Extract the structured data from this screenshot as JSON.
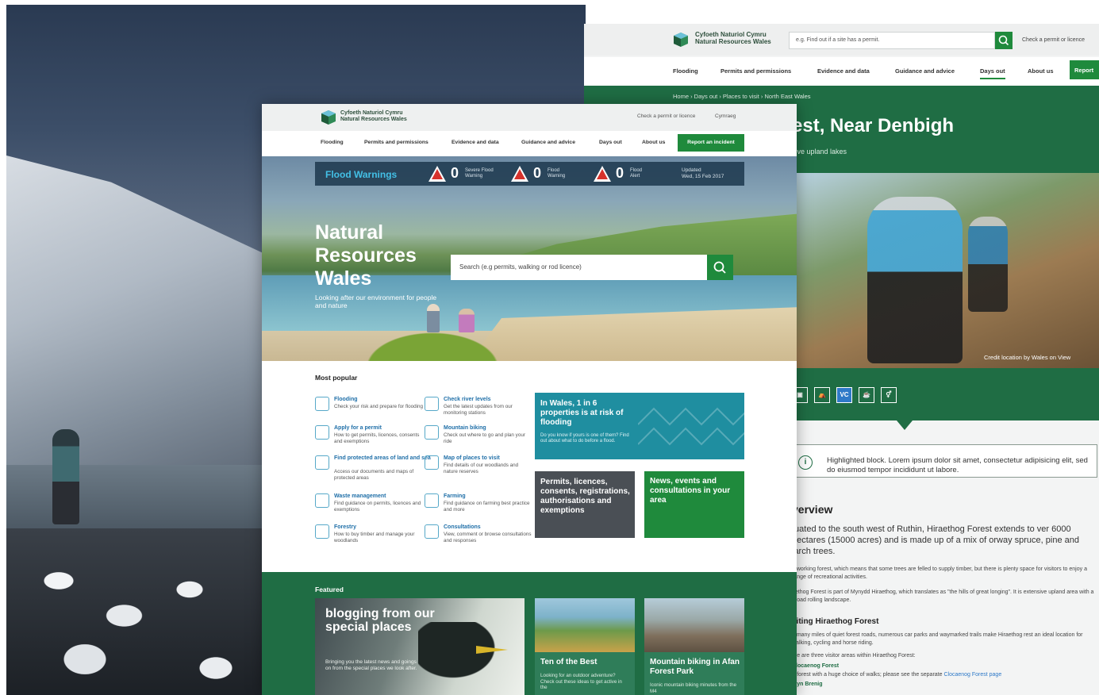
{
  "right_page": {
    "brand_line1": "Cyfoeth Naturiol Cymru",
    "brand_line2": "Natural Resources Wales",
    "search_placeholder": "e.g. Find out if a site has a permit.",
    "check_link": "Check a permit or licence",
    "nav": [
      "Flooding",
      "Permits and permissions",
      "Evidence and data",
      "Guidance and advice",
      "Days out",
      "About us"
    ],
    "report_button": "Report",
    "breadcrumb": "Home  ›  Days out  ›  Places to visit  ›  North East Wales",
    "title": "est, Near Denbigh",
    "subtitle": "sive upland lakes",
    "photo_credit": "Credit location by Wales on View",
    "facility_icons": [
      "parking-icon",
      "picnic-icon",
      "visitor-centre-icon",
      "cafe-icon",
      "toilets-icon"
    ],
    "facility_vc": "VC",
    "highlight": "Highlighted block. Lorem ipsum dolor sit amet, consectetur adipisicing elit, sed do eiusmod tempor incididunt ut labore.",
    "overview_heading": "verview",
    "overview_p1": "tuated to the south west of Ruthin, Hiraethog Forest extends to ver 6000 hectares (15000 acres) and is made up of a mix of orway spruce, pine and larch trees.",
    "overview_p2": "a working forest, which means that some trees are felled to supply timber, but there is plenty space for visitors to enjoy a range of recreational activities.",
    "overview_p3": "aethog Forest is part of Mynydd Hiraethog, which translates as \"the hills of great longing\". It is extensive upland area with a broad rolling landscape.",
    "visiting_heading": "siting Hiraethog Forest",
    "visiting_p1": "e many miles of quiet forest roads, numerous car parks and waymarked trails make Hiraethog rest an ideal location for walking, cycling and horse riding.",
    "visiting_p2": "ere are three visitor areas within Hiraethog Forest:",
    "link1": "Clocaenog Forest",
    "link1_desc": "A forest with a huge choice of walks; please see the separate ",
    "link1_desc_link": "Clocaenog Forest page",
    "link2": "Llyn Brenig"
  },
  "main_page": {
    "brand_line1": "Cyfoeth Naturiol Cymru",
    "brand_line2": "Natural Resources Wales",
    "check_link": "Check a permit or licence",
    "language_link": "Cymraeg",
    "nav": [
      "Flooding",
      "Permits and permissions",
      "Evidence and data",
      "Guidance and advice",
      "Days out",
      "About us"
    ],
    "report_button": "Report an incident",
    "flood": {
      "title": "Flood Warnings",
      "items": [
        {
          "count": "0",
          "label1": "Severe Flood",
          "label2": "Warning"
        },
        {
          "count": "0",
          "label1": "Flood",
          "label2": "Warning"
        },
        {
          "count": "0",
          "label1": "Flood",
          "label2": "Alert"
        }
      ],
      "updated_label": "Updated",
      "updated_date": "Wed, 15 Feb 2017"
    },
    "hero_title": "Natural\nResources\nWales",
    "hero_subtitle": "Looking after our environment for people and nature",
    "search_placeholder": "Search (e.g permits, walking or rod licence)",
    "most_popular_title": "Most popular",
    "popular": [
      {
        "title": "Flooding",
        "desc": "Check your risk and prepare for flooding"
      },
      {
        "title": "Check river levels",
        "desc": "Get the latest updates from our monitoring stations"
      },
      {
        "title": "Apply for a permit",
        "desc": "How to get permits, licences, consents and exemptions"
      },
      {
        "title": "Mountain biking",
        "desc": "Check out where to go and plan your ride"
      },
      {
        "title": "Find protected areas of land and sea",
        "desc": "Access our documents and maps of protected areas"
      },
      {
        "title": "Map of places to visit",
        "desc": "Find details of our woodlands and nature reserves"
      },
      {
        "title": "Waste management",
        "desc": "Find guidance on permits, licences and exemptions"
      },
      {
        "title": "Farming",
        "desc": "Find guidance on farming best practice and more"
      },
      {
        "title": "Forestry",
        "desc": "How to buy timber and manage your woodlands"
      },
      {
        "title": "Consultations",
        "desc": "View, comment or browse consultations and responses"
      }
    ],
    "tile_teal_heading": "In Wales, 1 in 6 properties is at risk of flooding",
    "tile_teal_text": "Do you know if yours is one of them? Find out about what to do before a flood.",
    "tile_grey_heading": "Permits, licences, consents, registrations, authorisations and exemptions",
    "tile_green_heading": "News, events and consultations in your area",
    "featured_title": "Featured",
    "featured_big_heading": "blogging from our special places",
    "featured_big_text": "Bringing you the latest news and goings on from the special places we look after.",
    "featured_cards": [
      {
        "heading": "Ten of the Best",
        "text": "Looking for an outdoor adventure? Check out these ideas to get active in the"
      },
      {
        "heading": "Mountain biking in Afan Forest Park",
        "text": "Iconic mountain biking minutes from the M4"
      }
    ]
  },
  "colors": {
    "brand_green": "#1f8a3c",
    "dark_green": "#1f6d44",
    "teal": "#1f8ea0",
    "flood_blue": "#43c0e6",
    "warning_red": "#d6322c"
  }
}
